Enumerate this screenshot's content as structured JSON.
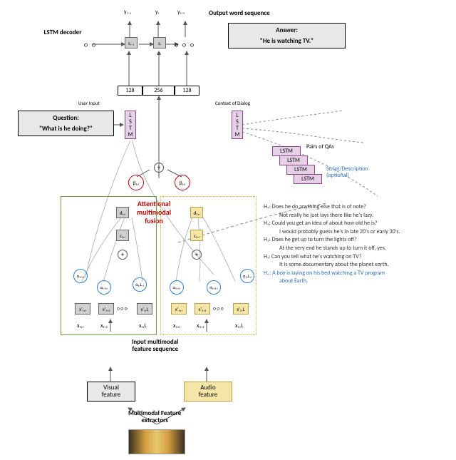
{
  "top_section": {
    "decoder_label": "LSTM decoder",
    "output_label": "Output word sequence",
    "y_prev": "yᵢ₋₁",
    "y_i": "yᵢ",
    "y_next": "yᵢ₊₁",
    "s_prev": "sᵢ₋₁",
    "s_i": "sᵢ",
    "answer_label": "Answer:",
    "answer_text": "\"He is watching TV.\"",
    "dim128_l": "128",
    "dim256": "256",
    "dim128_r": "128"
  },
  "user_input": {
    "label": "User Input",
    "question_label": "Question:",
    "question_text": "\"What is he doing?\"",
    "lstm_label": "L\nS\nT\nM"
  },
  "context": {
    "label": "Context of Dialog",
    "lstm_label": "L\nS\nT\nM",
    "pairs_label": "Pairs of QAs",
    "lstm_wide": "LSTM",
    "script_label": "Script/Description\n(optional)"
  },
  "fusion": {
    "beta1": "β₁,ᵢ",
    "beta2": "β₂,ᵢ",
    "d1": "d₁,ᵢ",
    "d2": "d₂,ᵢ",
    "c1": "c₁,ᵢ",
    "c2": "c₂,ᵢ",
    "title_l1": "Attentional",
    "title_l2": "multimodal",
    "title_l3": "fusion"
  },
  "visual": {
    "alpha11": "α₁,₁,ᵢ",
    "alpha12": "α₁,₂,ᵢ",
    "alpha1L": "α₁,L,ᵢ",
    "x11_h": "x'₁,₁",
    "x12_h": "x'₁,₂",
    "x1L_h": "x'₁,L",
    "x11": "x₁,₁",
    "x12": "x₁,₂",
    "x1L": "x₁,L",
    "feature_label": "Visual\nfeature"
  },
  "audio": {
    "alpha21": "α₂,₁,ᵢ",
    "alpha22": "α₂,₂,ᵢ",
    "alpha2L": "α₂,L,ᵢ",
    "x21_h": "x'₂,₁",
    "x22_h": "x'₂,₂",
    "x2L_h": "x'₂,L",
    "x21": "x₂,₁",
    "x22": "x₂,₂",
    "x2L": "x₂,L",
    "feature_label": "Audio\nfeature"
  },
  "bottom": {
    "input_seq_label": "Input multimodal\nfeature sequence",
    "extractors_label": "Multimodal Feature\nextractors"
  },
  "dialogue": {
    "h4q": "H₄: Does he do anything else that is of note?",
    "h4a": "Not really he just lays there like he's lazy.",
    "h3q": "H₃: Could you get an idea of about how old he is?",
    "h3a": "I would probably guess he's in late 20's or early 30's.",
    "h2q": "H₂: Does he get up to turn the lights off?",
    "h2a": "At the very end he stands up to turn it off, yes.",
    "h1q": "H₁: Can you tell what he's watching on TV?",
    "h1a": "It is some documentary about the planet earth.",
    "h0": "H₀: A boy is laying on his bed watching a TV program about Earth."
  }
}
